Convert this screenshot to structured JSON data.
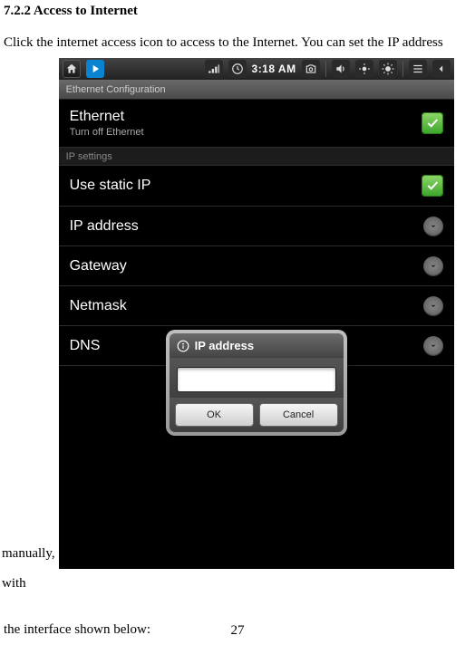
{
  "doc": {
    "heading": "7.2.2 Access to Internet",
    "para_pre": "Click the internet access icon to access to the Internet. You can set the IP address",
    "para_mid_left": "manually,",
    "para_mid_right": "with",
    "para_below": "the interface shown below:",
    "page_number": "27"
  },
  "statusbar": {
    "time": "3:18 AM"
  },
  "activity": {
    "title": "Ethernet Configuration"
  },
  "rows": {
    "ethernet": {
      "title": "Ethernet",
      "sub": "Turn off Ethernet"
    },
    "section_ip": "IP settings",
    "use_static": "Use static IP",
    "ip_address": "IP address",
    "gateway": "Gateway",
    "netmask": "Netmask",
    "dns": "DNS"
  },
  "dialog": {
    "title": "IP address",
    "input_value": "",
    "ok": "OK",
    "cancel": "Cancel"
  }
}
